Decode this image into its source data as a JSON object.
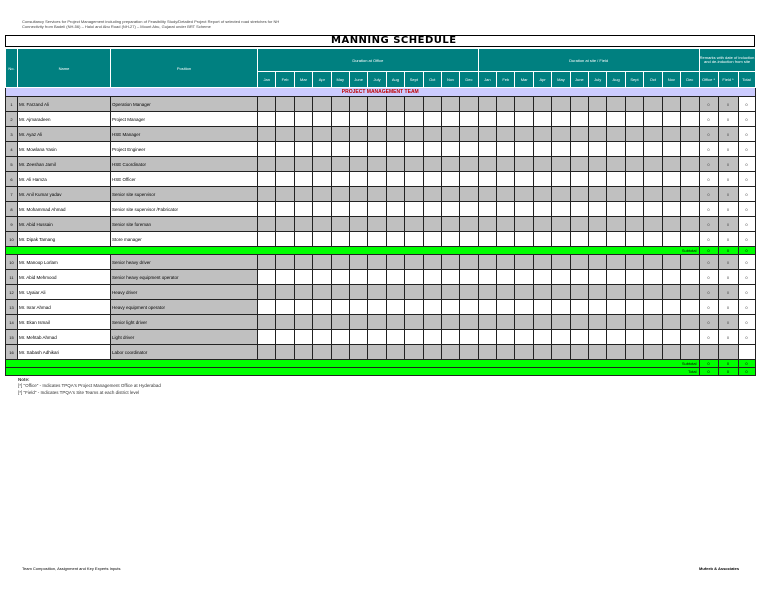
{
  "header": {
    "line1": "Consultancy Services for Project Management including preparation of Feasibility Study/Detailed Project Report of selected road stretches for NH",
    "line2": "Connectivity from Badeli (NH-56) – Halol and Abu Road (NH-27) – Mount Abu, Gujarat under BRT Scheme"
  },
  "title": "MANNING SCHEDULE",
  "columns": {
    "no": "No.",
    "name": "Name",
    "position": "Position",
    "office_group": "Duration at Office",
    "field_group": "Duration at site / Field",
    "remarks_group": "Remarks with date of induction and de-induction from site",
    "months": [
      "Jan",
      "Feb",
      "Mar",
      "Apr",
      "May",
      "June",
      "July",
      "Aug",
      "Sept",
      "Oct",
      "Nov",
      "Dec"
    ],
    "office": "Office *",
    "field": "Field *",
    "total": "Total"
  },
  "section_title": "PROJECT MANAGEMENT TEAM",
  "group1": [
    {
      "no": "1",
      "name": "Mr. Farzand Ali",
      "position": "Operation Manager",
      "office": "0",
      "field": "0",
      "total": "0"
    },
    {
      "no": "2",
      "name": "Mr. Ajmaradeen",
      "position": "Project Manager",
      "office": "0",
      "field": "0",
      "total": "0"
    },
    {
      "no": "3",
      "name": "Mr. Ayaz Ali",
      "position": "HSE Manager",
      "office": "0",
      "field": "0",
      "total": "0"
    },
    {
      "no": "4",
      "name": "Mr. Mowlana Yasin",
      "position": "Project Engineer",
      "office": "0",
      "field": "0",
      "total": "0"
    },
    {
      "no": "5",
      "name": "Mr. Zeeshan Jamil",
      "position": "HSE Coordinator",
      "office": "0",
      "field": "0",
      "total": "0"
    },
    {
      "no": "6",
      "name": "Mr. Ali Hamza",
      "position": "HSE Officer",
      "office": "0",
      "field": "0",
      "total": "0"
    },
    {
      "no": "7",
      "name": "Mr. Anil Kumar yadav",
      "position": "Senior site supervisor",
      "office": "0",
      "field": "0",
      "total": "0"
    },
    {
      "no": "8",
      "name": "Mr. Mohammad Ahmad",
      "position": "Senior site supervisor /Fabricator",
      "office": "0",
      "field": "0",
      "total": "0"
    },
    {
      "no": "9",
      "name": "Mr. Abid Hussain",
      "position": "Senior site foreman",
      "office": "0",
      "field": "0",
      "total": "0"
    },
    {
      "no": "10",
      "name": "Mr. Dipak Tamang",
      "position": "Store manager",
      "office": "0",
      "field": "0",
      "total": "0"
    }
  ],
  "subtotal1": {
    "label": "Subtotal",
    "office": "0",
    "field": "0",
    "total": "0"
  },
  "group2": [
    {
      "no": "10",
      "name": "Mr. Manoop Lorlam",
      "position": "Senior heavy driver",
      "office": "0",
      "field": "0",
      "total": "0"
    },
    {
      "no": "11",
      "name": "Mr. Abid Mehmood",
      "position": "Senior heavy equipment operator",
      "office": "0",
      "field": "0",
      "total": "0"
    },
    {
      "no": "12",
      "name": "Mr. Uyaiar Ali",
      "position": "Heavy driver",
      "office": "0",
      "field": "0",
      "total": "0"
    },
    {
      "no": "13",
      "name": "Mr. Israr Ahmad",
      "position": "Heavy equipment operator",
      "office": "0",
      "field": "0",
      "total": "0"
    },
    {
      "no": "14",
      "name": "Mr. Ekan Ismail",
      "position": "Senior light driver",
      "office": "0",
      "field": "0",
      "total": "0"
    },
    {
      "no": "15",
      "name": "Mr. Mehtab Ahmad",
      "position": "Light driver",
      "office": "0",
      "field": "0",
      "total": "0"
    },
    {
      "no": "16",
      "name": "Mr. Sabash Adhikari",
      "position": "Labor coordinator",
      "office": "",
      "field": "",
      "total": ""
    }
  ],
  "subtotal2": {
    "label": "Subtotal",
    "office": "0",
    "field": "0",
    "total": "0"
  },
  "grand_total": {
    "label": "Total",
    "office": "0",
    "field": "0",
    "total": "0"
  },
  "notes": {
    "title": "Note:",
    "items": [
      "[*] \"Office\" - Indicates TPQA's Project Management Office at Hyderabad",
      "[*] \"Field\" - Indicates TPQA's Site Teams at each district level"
    ]
  },
  "footer": {
    "left": "Team Composition, Assignment and Key Experts Inputs",
    "right": "Mufeeb & Associates"
  },
  "colors": {
    "header": "#008080",
    "band": "#ccccff",
    "subtotal": "#00ff00",
    "shade": "#c0c0c0"
  }
}
